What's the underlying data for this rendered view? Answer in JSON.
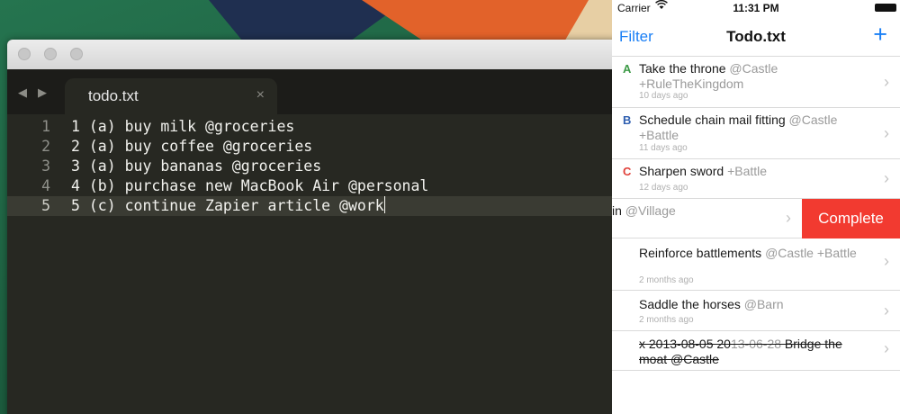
{
  "editor": {
    "tab_label": "todo.txt",
    "tab_close": "×",
    "nav_back": "◀",
    "nav_forward": "▶",
    "lines": [
      {
        "number": "1",
        "text": "1 (a) buy milk @groceries"
      },
      {
        "number": "2",
        "text": "2 (a) buy coffee @groceries"
      },
      {
        "number": "3",
        "text": "3 (a) buy bananas @groceries"
      },
      {
        "number": "4",
        "text": "4 (b) purchase new MacBook Air @personal"
      },
      {
        "number": "5",
        "text": "5 (c) continue Zapier article @work"
      }
    ]
  },
  "phone": {
    "status": {
      "carrier": "Carrier",
      "time": "11:31 PM"
    },
    "nav": {
      "filter": "Filter",
      "title": "Todo.txt",
      "add": "+"
    },
    "colors": {
      "accent": "#1a7ff5",
      "complete": "#f23a30",
      "prio_a": "#3d9a47",
      "prio_b": "#2f5fb0",
      "prio_c": "#e0413a"
    },
    "tasks": [
      {
        "prio": "A",
        "text": "Take the throne ",
        "ctx": "@Castle +RuleTheKingdom",
        "age": "10 days ago"
      },
      {
        "prio": "B",
        "text": "Schedule chain mail fitting ",
        "ctx": "@Castle +Battle",
        "age": "11 days ago"
      },
      {
        "prio": "C",
        "text": "Sharpen sword ",
        "ctx": "+Battle",
        "age": "12 days ago"
      },
      {
        "prio": "",
        "text": "in ",
        "ctx": "@Village",
        "age": "",
        "action": "Complete"
      },
      {
        "prio": "",
        "text": "Reinforce battlements ",
        "ctx": "@Castle +Battle",
        "age": "2 months ago"
      },
      {
        "prio": "",
        "text": "Saddle the horses ",
        "ctx": "@Barn",
        "age": "2 months ago"
      },
      {
        "prio": "",
        "text": "x 2013-08-05 20",
        "ctx": "13-06-28",
        "text2": " Bridge the moat @Castle",
        "age": ""
      }
    ]
  }
}
